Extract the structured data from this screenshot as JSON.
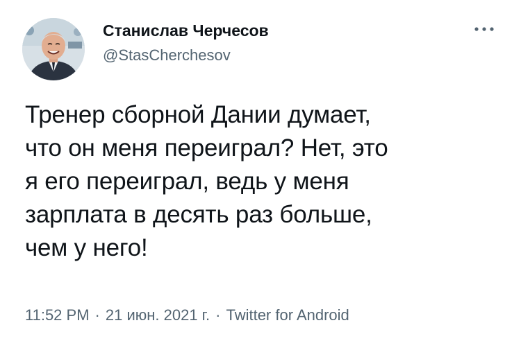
{
  "author": {
    "display_name": "Станислав Черчесов",
    "handle": "@StasCherchesov"
  },
  "avatar_icon": "person-avatar-icon",
  "more_icon": "more-horizontal-icon",
  "tweet_text": "Тренер сборной Дании думает,\nчто он меня переиграл? Нет, это\nя его переиграл, ведь у меня\nзарплата в десять раз больше,\nчем у него!",
  "meta": {
    "time": "11:52 PM",
    "separator": "·",
    "date": "21 июн. 2021 г.",
    "source": "Twitter for Android"
  },
  "colors": {
    "text": "#0f1419",
    "secondary": "#536471"
  }
}
